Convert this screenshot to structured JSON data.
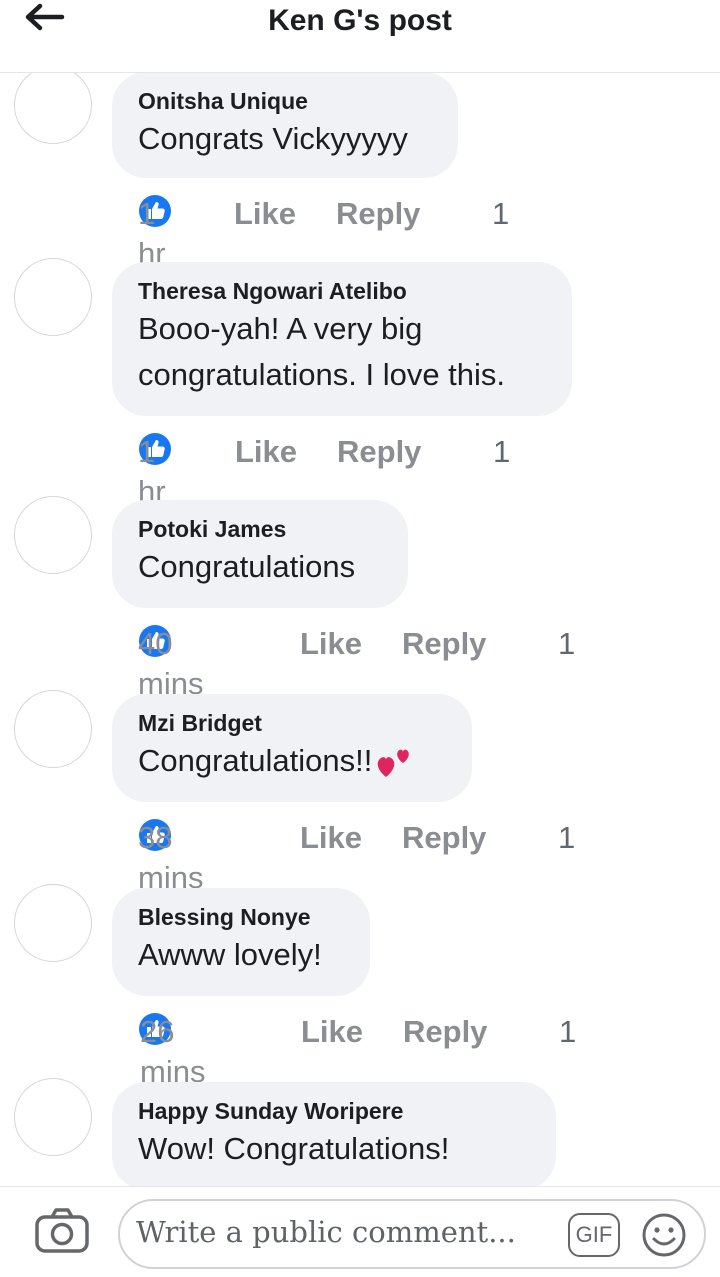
{
  "header": {
    "title": "Ken G's post"
  },
  "comments": [
    {
      "author": "Onitsha Unique",
      "text": "Congrats Vickyyyyy",
      "time": "1 hr",
      "like": "Like",
      "reply": "Reply",
      "reactions": "1"
    },
    {
      "author": "Theresa Ngowari Atelibo",
      "text": "Booo-yah!  A very big\ncongratulations. I love this.",
      "time": "1 hr",
      "like": "Like",
      "reply": "Reply",
      "reactions": "1"
    },
    {
      "author": "Potoki James",
      "text": "Congratulations",
      "time": "40 mins",
      "like": "Like",
      "reply": "Reply",
      "reactions": "1"
    },
    {
      "author": "Mzi Bridget",
      "text": "Congratulations!!",
      "time": "38 mins",
      "like": "Like",
      "reply": "Reply",
      "reactions": "1"
    },
    {
      "author": "Blessing Nonye",
      "text": "Awww lovely!",
      "time": "26 mins",
      "like": "Like",
      "reply": "Reply",
      "reactions": "1"
    },
    {
      "author": "Happy Sunday Woripere",
      "text": "Wow! Congratulations!"
    }
  ],
  "composer": {
    "placeholder": "Write a public comment...",
    "gif_label": "GIF"
  },
  "icons": {
    "back": "arrow-left-icon",
    "camera": "camera-icon",
    "emoji": "smiley-icon",
    "reaction": "thumbs-up-icon",
    "sticker": "two-hearts-icon"
  },
  "colors": {
    "accent": "#1877f2",
    "bubble": "#f0f2f5",
    "muted": "#8a8d91"
  }
}
